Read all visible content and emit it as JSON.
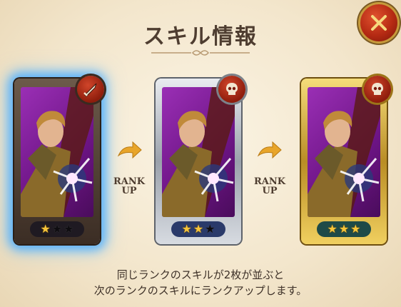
{
  "dialog": {
    "title": "スキル情報",
    "close_icon": "close-x-icon",
    "description_line1": "同じランクのスキルが2枚が並ぶと",
    "description_line2": "次のランクのスキルにランクアップします。"
  },
  "cards": [
    {
      "frame": "bronze",
      "skill_icon": "sword-icon",
      "stars_filled": 1,
      "stars_total": 3,
      "highlighted": true
    },
    {
      "frame": "silver",
      "skill_icon": "skull-icon",
      "stars_filled": 2,
      "stars_total": 3,
      "highlighted": false
    },
    {
      "frame": "gold",
      "skill_icon": "skull-icon",
      "stars_filled": 3,
      "stars_total": 3,
      "highlighted": false
    }
  ],
  "transitions": [
    {
      "line1": "RANK",
      "line2": "UP"
    },
    {
      "line1": "RANK",
      "line2": "UP"
    }
  ],
  "colors": {
    "background": "#f3e6cc",
    "title": "#4e3d30",
    "highlight_glow": "#46aaff",
    "arrow": "#e8a52a",
    "star_on": "#f6c43a"
  }
}
